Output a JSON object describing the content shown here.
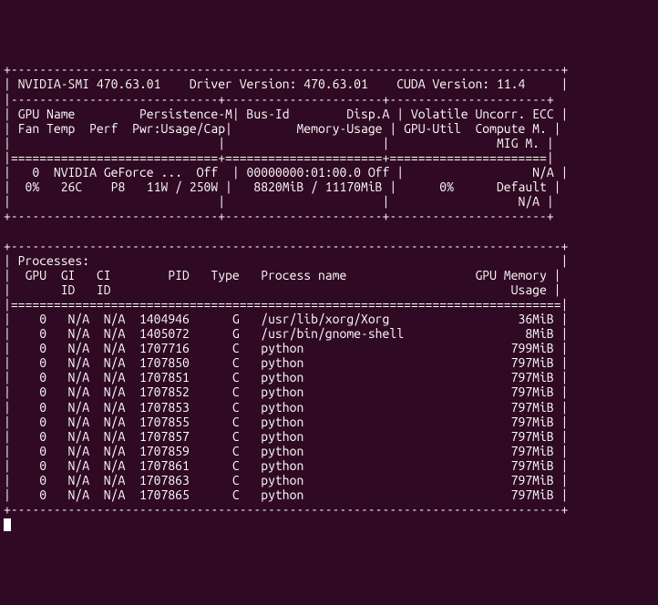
{
  "chart_data": {
    "type": "table",
    "title": "nvidia-smi output",
    "header": {
      "smi_version": "470.63.01",
      "driver_version": "470.63.01",
      "cuda_version": "11.4"
    },
    "gpus": [
      {
        "index": 0,
        "name": "NVIDIA GeForce ...",
        "persistence_m": "Off",
        "bus_id": "00000000:01:00.0",
        "disp_a": "Off",
        "volatile_uncorr_ecc": "N/A",
        "fan": "0%",
        "temp": "26C",
        "perf": "P8",
        "pwr_usage": "11W",
        "pwr_cap": "250W",
        "memory_used": "8820MiB",
        "memory_total": "11170MiB",
        "gpu_util": "0%",
        "compute_m": "Default",
        "mig_m": "N/A"
      }
    ],
    "processes": [
      {
        "gpu": 0,
        "gi_id": "N/A",
        "ci_id": "N/A",
        "pid": 1404946,
        "type": "G",
        "name": "/usr/lib/xorg/Xorg",
        "gpu_memory": "36MiB"
      },
      {
        "gpu": 0,
        "gi_id": "N/A",
        "ci_id": "N/A",
        "pid": 1405072,
        "type": "G",
        "name": "/usr/bin/gnome-shell",
        "gpu_memory": "8MiB"
      },
      {
        "gpu": 0,
        "gi_id": "N/A",
        "ci_id": "N/A",
        "pid": 1707716,
        "type": "C",
        "name": "python",
        "gpu_memory": "799MiB"
      },
      {
        "gpu": 0,
        "gi_id": "N/A",
        "ci_id": "N/A",
        "pid": 1707850,
        "type": "C",
        "name": "python",
        "gpu_memory": "797MiB"
      },
      {
        "gpu": 0,
        "gi_id": "N/A",
        "ci_id": "N/A",
        "pid": 1707851,
        "type": "C",
        "name": "python",
        "gpu_memory": "797MiB"
      },
      {
        "gpu": 0,
        "gi_id": "N/A",
        "ci_id": "N/A",
        "pid": 1707852,
        "type": "C",
        "name": "python",
        "gpu_memory": "797MiB"
      },
      {
        "gpu": 0,
        "gi_id": "N/A",
        "ci_id": "N/A",
        "pid": 1707853,
        "type": "C",
        "name": "python",
        "gpu_memory": "797MiB"
      },
      {
        "gpu": 0,
        "gi_id": "N/A",
        "ci_id": "N/A",
        "pid": 1707855,
        "type": "C",
        "name": "python",
        "gpu_memory": "797MiB"
      },
      {
        "gpu": 0,
        "gi_id": "N/A",
        "ci_id": "N/A",
        "pid": 1707857,
        "type": "C",
        "name": "python",
        "gpu_memory": "797MiB"
      },
      {
        "gpu": 0,
        "gi_id": "N/A",
        "ci_id": "N/A",
        "pid": 1707859,
        "type": "C",
        "name": "python",
        "gpu_memory": "797MiB"
      },
      {
        "gpu": 0,
        "gi_id": "N/A",
        "ci_id": "N/A",
        "pid": 1707861,
        "type": "C",
        "name": "python",
        "gpu_memory": "797MiB"
      },
      {
        "gpu": 0,
        "gi_id": "N/A",
        "ci_id": "N/A",
        "pid": 1707863,
        "type": "C",
        "name": "python",
        "gpu_memory": "797MiB"
      },
      {
        "gpu": 0,
        "gi_id": "N/A",
        "ci_id": "N/A",
        "pid": 1707865,
        "type": "C",
        "name": "python",
        "gpu_memory": "797MiB"
      }
    ]
  },
  "labels": {
    "gpu": "GPU",
    "name": "Name",
    "persistence_m": "Persistence-M",
    "bus_id": "Bus-Id",
    "disp_a": "Disp.A",
    "volatile_uncorr_ecc": "Volatile Uncorr. ECC",
    "fan": "Fan",
    "temp": "Temp",
    "perf": "Perf",
    "pwr_usage_cap": "Pwr:Usage/Cap",
    "memory_usage": "Memory-Usage",
    "gpu_util": "GPU-Util",
    "compute_m": "Compute M.",
    "mig_m": "MIG M.",
    "processes": "Processes:",
    "gi": "GI",
    "ci": "CI",
    "id": "ID",
    "pid": "PID",
    "type": "Type",
    "process_name": "Process name",
    "gpu_memory": "GPU Memory",
    "usage": "Usage",
    "nvidia_smi": "NVIDIA-SMI",
    "driver_version": "Driver Version:",
    "cuda_version": "CUDA Version:"
  }
}
